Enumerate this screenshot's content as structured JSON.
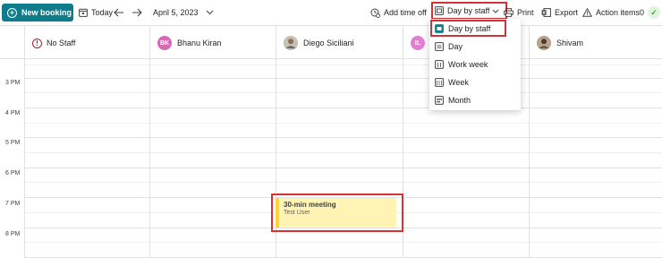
{
  "toolbar": {
    "new_booking": "New booking",
    "today": "Today",
    "date": "April 5, 2023",
    "add_time_off": "Add time off",
    "view_selected": "Day by staff",
    "print": "Print",
    "export": "Export",
    "action_items": "Action items0"
  },
  "staff": [
    {
      "name": "No Staff",
      "avatar": ""
    },
    {
      "name": "Bhanu Kiran",
      "avatar": "BK",
      "color": "#d66bb3"
    },
    {
      "name": "Diego Siciliani",
      "avatar": "",
      "color": "#8a8886"
    },
    {
      "name": "",
      "avatar": "IL",
      "color": "#e17fd0"
    },
    {
      "name": "Shivam",
      "avatar": "",
      "color": "#7a6a5a"
    }
  ],
  "times": [
    "3 PM",
    "4 PM",
    "5 PM",
    "6 PM",
    "7 PM",
    "8 PM"
  ],
  "event": {
    "title": "30-min meeting",
    "subtitle": "Test User",
    "color": "#fff4b3",
    "accent": "#ffd335"
  },
  "view_menu": {
    "options": [
      "Day by staff",
      "Day",
      "Work week",
      "Week",
      "Month"
    ],
    "selected": "Day by staff"
  },
  "colors": {
    "brand": "#0f7c8c",
    "highlight": "#d13438"
  }
}
